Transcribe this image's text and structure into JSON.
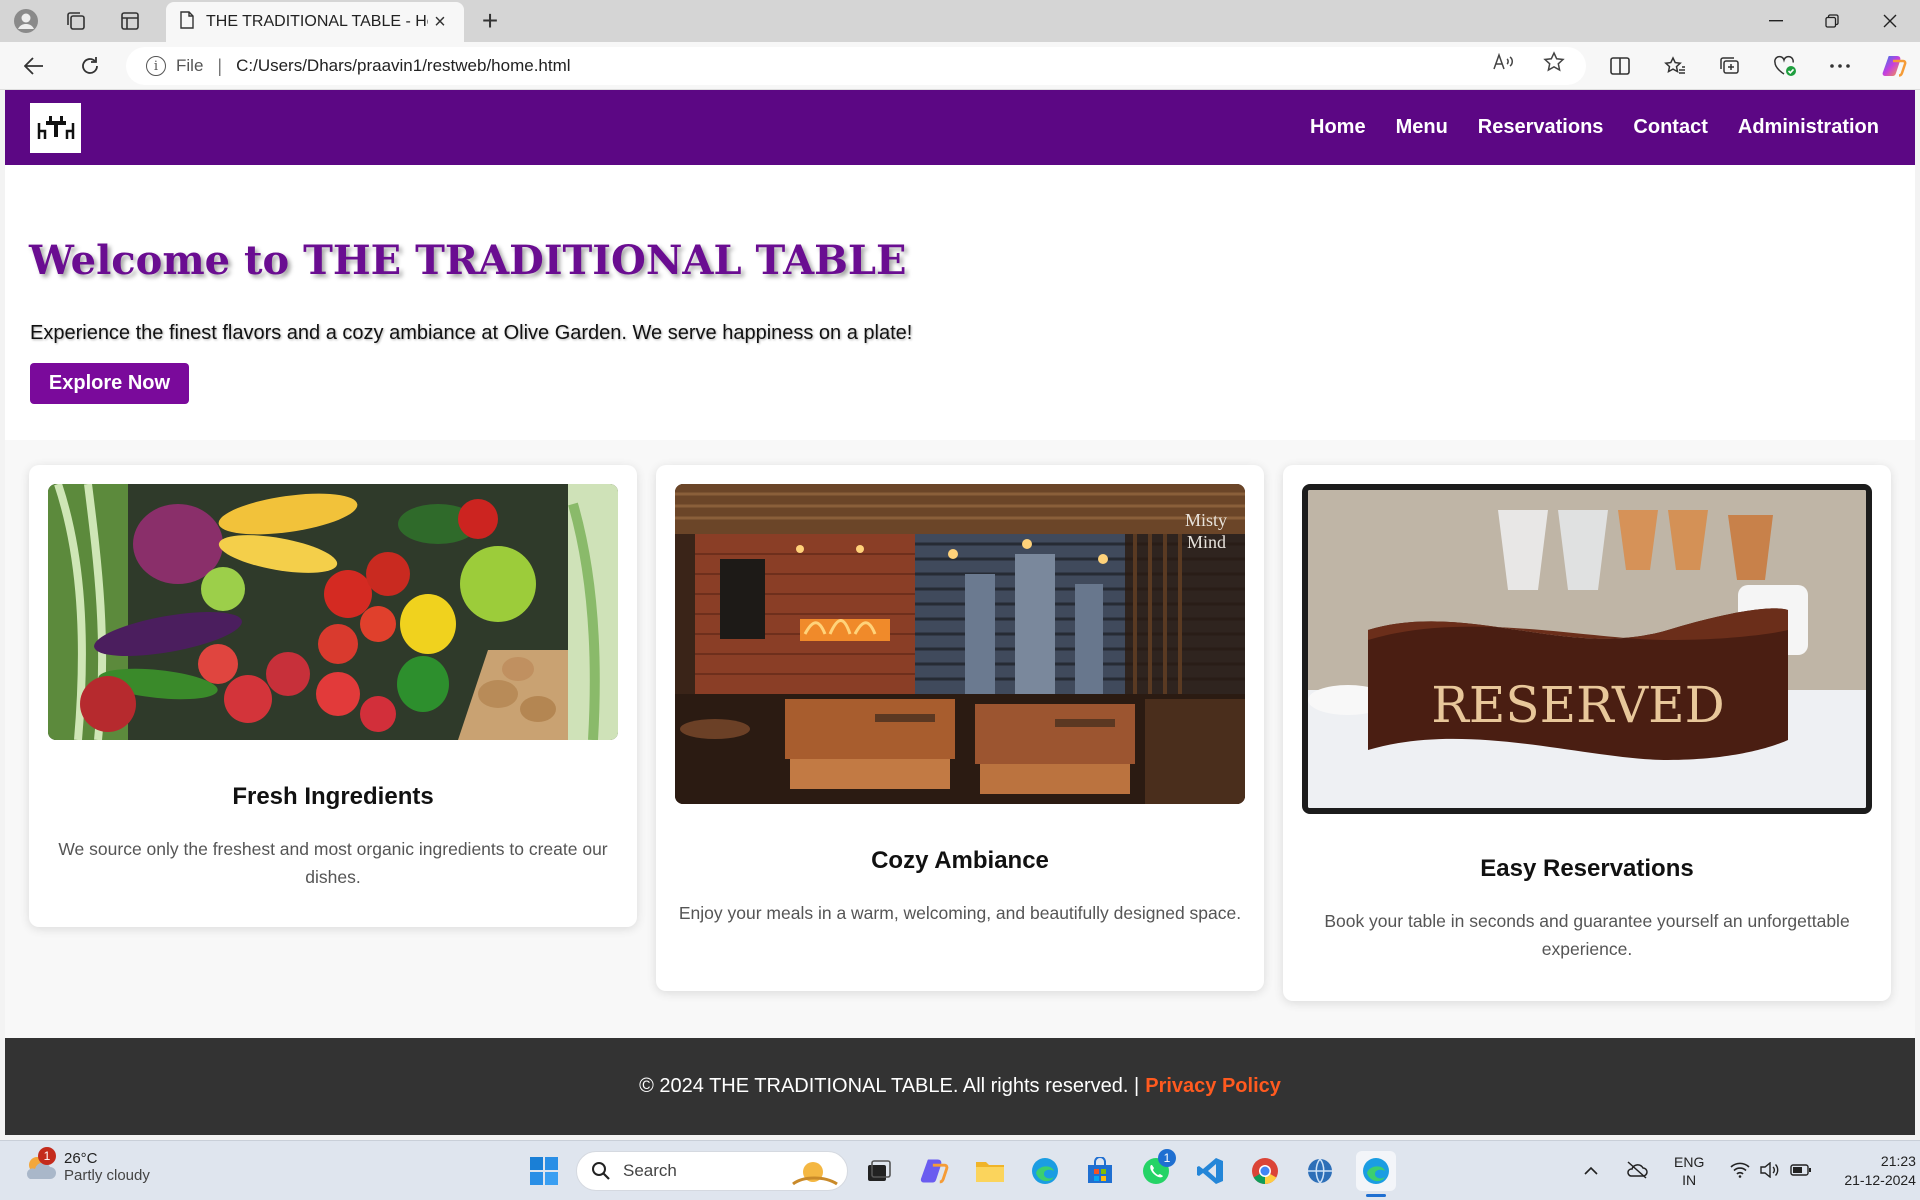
{
  "browser": {
    "tab_title": "THE TRADITIONAL TABLE - Home",
    "file_label": "File",
    "separator": "|",
    "url": "C:/Users/Dhars/praavin1/restweb/home.html"
  },
  "site": {
    "nav": {
      "links": [
        "Home",
        "Menu",
        "Reservations",
        "Contact",
        "Administration"
      ]
    },
    "hero": {
      "title": "Welcome to THE TRADITIONAL TABLE",
      "subtitle": "Experience the finest flavors and a cozy ambiance at Olive Garden. We serve happiness on a plate!",
      "button": "Explore Now"
    },
    "features": [
      {
        "title": "Fresh Ingredients",
        "text": "We source only the freshest and most organic ingredients to create our dishes."
      },
      {
        "title": "Cozy Ambiance",
        "text": "Enjoy your meals in a warm, welcoming, and beautifully designed space.",
        "image_watermark": [
          "Misty",
          "Mind"
        ]
      },
      {
        "title": "Easy Reservations",
        "text": "Book your table in seconds and guarantee yourself an unforgettable experience.",
        "image_sign": "RESERVED"
      }
    ],
    "footer": {
      "text": "© 2024 THE TRADITIONAL TABLE. All rights reserved. |",
      "link": "Privacy Policy"
    }
  },
  "taskbar": {
    "weather_temp": "26°C",
    "weather_condition": "Partly cloudy",
    "weather_badge": "1",
    "search_label": "Search",
    "whatsapp_badge": "1",
    "lang_top": "ENG",
    "lang_bottom": "IN",
    "time": "21:23",
    "date": "21-12-2024"
  },
  "colors": {
    "brand_purple": "#5c0784",
    "title_purple": "#6a0d91",
    "button_purple": "#7a0a9b",
    "footer_bg": "#333333",
    "footer_link": "#ff5a1f"
  }
}
